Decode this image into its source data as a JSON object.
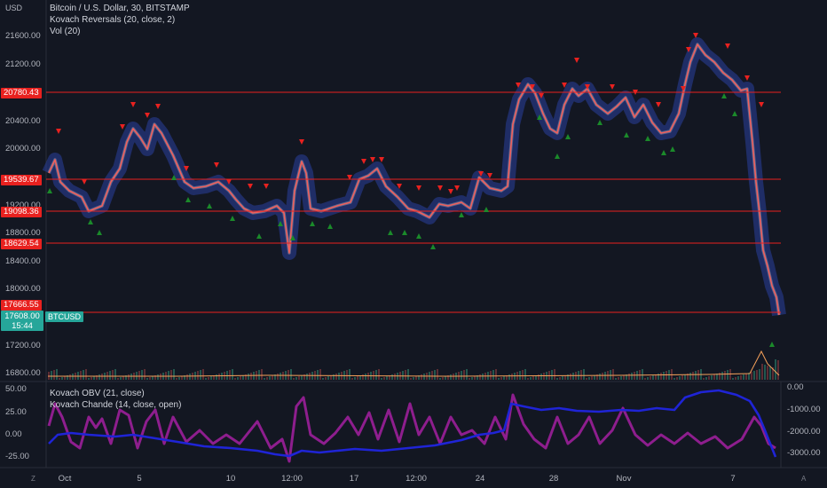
{
  "header": {
    "currency": "USD",
    "title": "Bitcoin / U.S. Dollar, 30, BITSTAMP",
    "indicator_1": "Kovach Reversals (20, close, 2)",
    "indicator_2": "Vol (20)"
  },
  "lower_pane": {
    "indicator_1": "Kovach OBV (21, close)",
    "indicator_2": "Kovach Chande (14, close, open)"
  },
  "price_axis": [
    "21600.00",
    "21200.00",
    "20400.00",
    "20000.00",
    "19200.00",
    "18800.00",
    "18400.00",
    "18000.00",
    "17200.00",
    "16800.00"
  ],
  "levels": [
    "20780.43",
    "19539.67",
    "19098.36",
    "18629.54",
    "17666.55"
  ],
  "current_price": {
    "price": "17608.00",
    "countdown": "15:44",
    "symbol": "BTCUSD"
  },
  "left_osc_axis": [
    "50.00",
    "25.00",
    "0.00",
    "-25.00"
  ],
  "right_osc_axis": [
    "0.00",
    "-1000.00",
    "-2000.00",
    "-3000.00"
  ],
  "time_axis": [
    "Oct",
    "5",
    "10",
    "12:00",
    "17",
    "12:00",
    "24",
    "28",
    "Nov",
    "7"
  ],
  "corner": {
    "left": "Z",
    "right": "A"
  },
  "colors": {
    "background": "#131722",
    "level_line": "#e8211f",
    "price_line": "#f0605d",
    "band": "#2a3f9e",
    "sell_marker": "#e8211f",
    "buy_marker": "#1b8a2a",
    "osc_purple": "#8e1e8e",
    "osc_blue": "#1f24d6",
    "price_badge": "#26a69a"
  }
}
